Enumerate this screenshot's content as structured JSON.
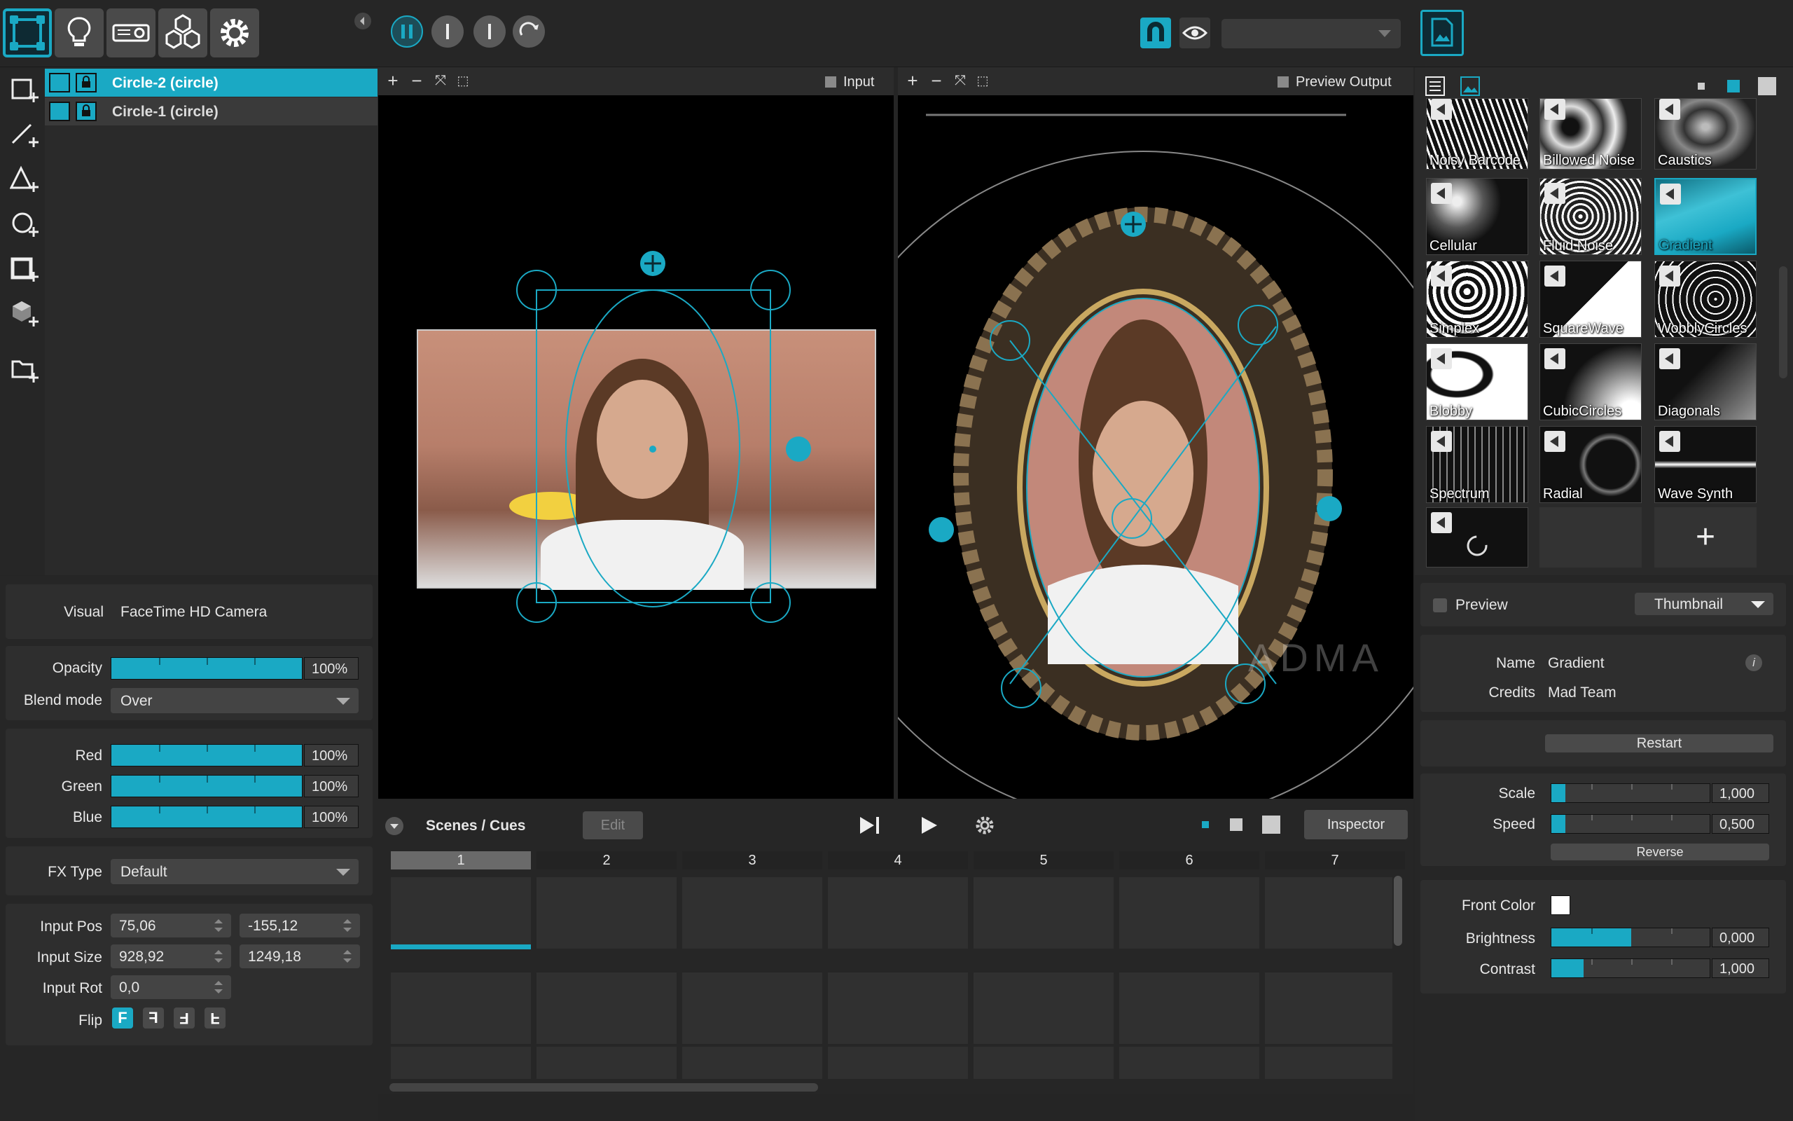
{
  "toolbar": {
    "icons": [
      "mapping-icon",
      "lightbulb-icon",
      "projector-icon",
      "cubes-icon",
      "gear-icon"
    ],
    "playback": [
      "pause-icon",
      "stop-icon",
      "stop-icon",
      "loop-icon"
    ],
    "output_dropdown_value": ""
  },
  "layers": [
    {
      "name": "Circle-2 (circle)",
      "selected": true
    },
    {
      "name": "Circle-1 (circle)",
      "selected": false
    }
  ],
  "input_view": {
    "label": "Input"
  },
  "output_view": {
    "label": "Preview Output"
  },
  "properties": {
    "visual_label": "Visual",
    "visual_value": "FaceTime HD Camera",
    "opacity_label": "Opacity",
    "opacity_value": "100%",
    "opacity_level": 1.0,
    "blend_label": "Blend mode",
    "blend_value": "Over",
    "red_label": "Red",
    "red_value": "100%",
    "green_label": "Green",
    "green_value": "100%",
    "blue_label": "Blue",
    "blue_value": "100%",
    "fx_label": "FX Type",
    "fx_value": "Default",
    "input_pos_label": "Input Pos",
    "input_pos_x": "75,06",
    "input_pos_y": "-155,12",
    "input_size_label": "Input Size",
    "input_size_w": "928,92",
    "input_size_h": "1249,18",
    "input_rot_label": "Input Rot",
    "input_rot_value": "0,0",
    "flip_label": "Flip",
    "flip_options": [
      "F",
      "F",
      "F",
      "F"
    ]
  },
  "cues": {
    "title": "Scenes / Cues",
    "edit_label": "Edit",
    "inspector_label": "Inspector",
    "columns": [
      "1",
      "2",
      "3",
      "4",
      "5",
      "6",
      "7"
    ]
  },
  "library": {
    "items": [
      "Noisy Barcode",
      "Billowed Noise",
      "Caustics",
      "Cellular",
      "Fluid Noise",
      "Gradient",
      "Simplex",
      "SquareWave",
      "WobblyCircles",
      "Blobby",
      "CubicCircles",
      "Diagonals",
      "Spectrum",
      "Radial",
      "Wave Synth"
    ],
    "selected": "Gradient",
    "add_label": "+"
  },
  "inspector": {
    "preview_label": "Preview",
    "thumbnail_value": "Thumbnail",
    "name_label": "Name",
    "name_value": "Gradient",
    "credits_label": "Credits",
    "credits_value": "Mad Team",
    "restart_label": "Restart",
    "scale_label": "Scale",
    "scale_value": "1,000",
    "speed_label": "Speed",
    "speed_value": "0,500",
    "reverse_label": "Reverse",
    "front_color_label": "Front Color",
    "front_color": "#ffffff",
    "brightness_label": "Brightness",
    "brightness_value": "0,000",
    "contrast_label": "Contrast",
    "contrast_value": "1,000"
  },
  "watermark": "ADMA",
  "colors": {
    "accent": "#1aa9c4",
    "panel": "#2e2e2e",
    "background": "#252525"
  }
}
